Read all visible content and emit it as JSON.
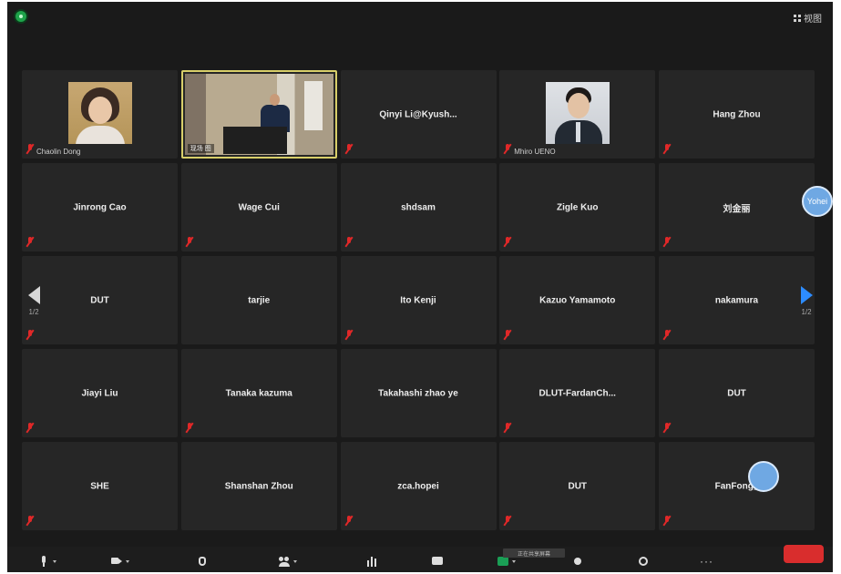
{
  "topbar": {
    "view_label": "视图"
  },
  "tiles": [
    {
      "name": "Chaolin Dong",
      "type": "photo-woman",
      "muted": true
    },
    {
      "name": "现场 图",
      "type": "live",
      "muted": false,
      "active": true
    },
    {
      "name": "Qinyi  Li@Kyush...",
      "type": "text",
      "muted": true
    },
    {
      "name": "Mhiro UENO",
      "type": "photo-man",
      "muted": true
    },
    {
      "name": "Hang Zhou",
      "type": "text",
      "muted": true
    },
    {
      "name": "Jinrong Cao",
      "type": "text",
      "muted": true
    },
    {
      "name": "Wage Cui",
      "type": "text",
      "muted": true
    },
    {
      "name": "shdsam",
      "type": "text",
      "muted": true
    },
    {
      "name": "Zigle Kuo",
      "type": "text",
      "muted": true
    },
    {
      "name": "刘金丽",
      "type": "text",
      "muted": true
    },
    {
      "name": "DUT",
      "type": "text",
      "muted": true
    },
    {
      "name": "tarjie",
      "type": "text",
      "muted": false
    },
    {
      "name": "Ito Kenji",
      "type": "text",
      "muted": true
    },
    {
      "name": "Kazuo Yamamoto",
      "type": "text",
      "muted": true
    },
    {
      "name": "nakamura",
      "type": "text",
      "muted": true
    },
    {
      "name": "Jiayi Liu",
      "type": "text",
      "muted": true
    },
    {
      "name": "Tanaka kazuma",
      "type": "text",
      "muted": true
    },
    {
      "name": "Takahashi zhao ye",
      "type": "text",
      "muted": false
    },
    {
      "name": "DLUT-FardanCh...",
      "type": "text",
      "muted": true
    },
    {
      "name": "DUT",
      "type": "text",
      "muted": true
    },
    {
      "name": "SHE",
      "type": "text",
      "muted": true
    },
    {
      "name": "Shanshan Zhou",
      "type": "text",
      "muted": false
    },
    {
      "name": "zca.hopei",
      "type": "text",
      "muted": true
    },
    {
      "name": "DUT",
      "type": "text",
      "muted": true
    },
    {
      "name": "FanFong_",
      "type": "text",
      "muted": true
    }
  ],
  "side_avatar_label": "Yohei",
  "nav": {
    "left_page": "1/2",
    "right_page": "1/2"
  },
  "toolbar": {
    "share_tooltip": "正在共享屏幕",
    "items": [
      "mic-icon",
      "video-icon",
      "security-icon",
      "participants-icon",
      "polls-icon",
      "chat-icon",
      "share-screen-icon",
      "record-icon",
      "reactions-icon",
      "more-icon"
    ]
  },
  "colors": {
    "background": "#1a1a1a",
    "tile": "#262626",
    "active_border": "#d8cf6a",
    "mute_red": "#e02828",
    "accent_blue": "#2d8cff",
    "share_green": "#1a9e55",
    "end_red": "#d92d2d"
  }
}
